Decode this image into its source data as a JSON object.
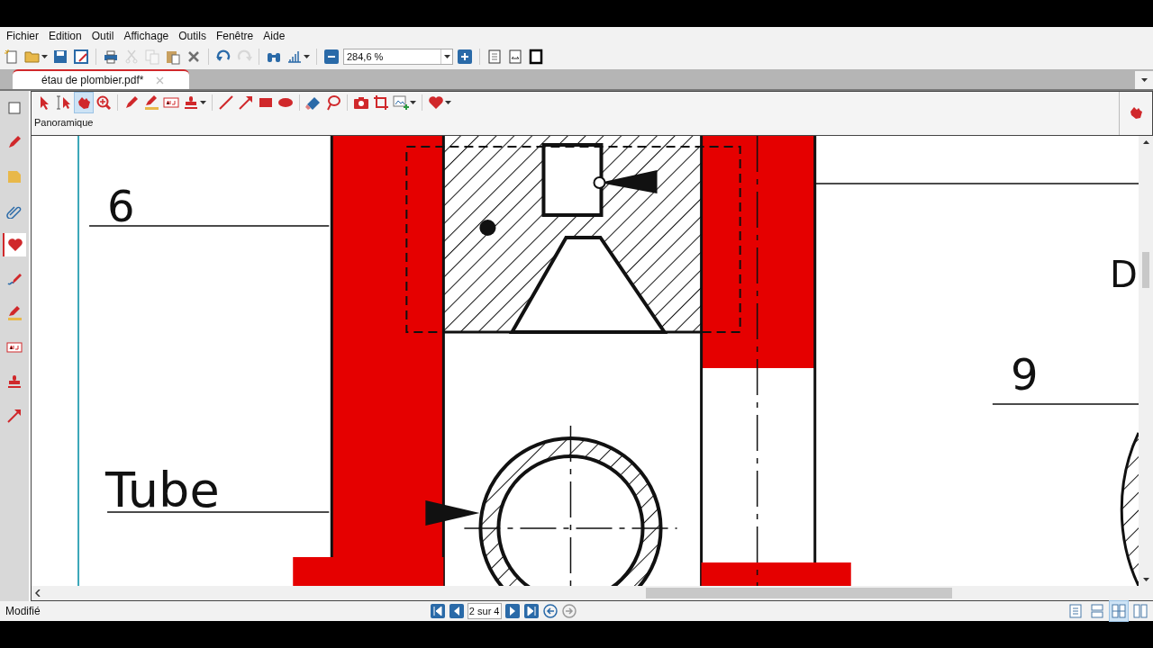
{
  "menu": [
    {
      "label": "Fichier"
    },
    {
      "label": "Edition"
    },
    {
      "label": "Outil"
    },
    {
      "label": "Affichage"
    },
    {
      "label": "Outils"
    },
    {
      "label": "Fenêtre"
    },
    {
      "label": "Aide"
    }
  ],
  "toolbar": {
    "groups": [
      [
        {
          "kind": "new",
          "disabled": false
        },
        {
          "kind": "open",
          "disabled": false
        },
        {
          "kind": "save",
          "disabled": false
        },
        {
          "kind": "saveas",
          "disabled": false
        }
      ],
      [
        {
          "kind": "print",
          "disabled": false
        },
        {
          "kind": "cut",
          "disabled": true
        },
        {
          "kind": "copy",
          "disabled": true
        },
        {
          "kind": "paste",
          "disabled": false
        },
        {
          "kind": "delete",
          "disabled": false
        }
      ],
      [
        {
          "kind": "undo",
          "disabled": false
        },
        {
          "kind": "redo",
          "disabled": true
        }
      ],
      [
        {
          "kind": "find",
          "disabled": false
        },
        {
          "kind": "tools",
          "disabled": false
        }
      ],
      [
        {
          "kind": "zoomout",
          "disabled": false
        },
        {
          "kind": "zoomfield",
          "disabled": false
        },
        {
          "kind": "zoomin",
          "disabled": false
        }
      ],
      [
        {
          "kind": "fitpage",
          "disabled": false
        },
        {
          "kind": "fitwidth",
          "disabled": false
        },
        {
          "kind": "fullscreen",
          "disabled": false
        }
      ]
    ],
    "zoom_value": "284,6 %"
  },
  "tab": {
    "title": "étau de plombier.pdf*"
  },
  "annotation_toolbar": {
    "mode_label": "Panoramique",
    "groups": [
      [
        {
          "kind": "select",
          "selected": false
        },
        {
          "kind": "textselect",
          "selected": false
        },
        {
          "kind": "hand",
          "selected": true
        },
        {
          "kind": "zoom",
          "selected": false
        }
      ],
      [
        {
          "kind": "pen",
          "selected": false
        },
        {
          "kind": "highlighter",
          "selected": false
        },
        {
          "kind": "textbox",
          "selected": false
        },
        {
          "kind": "stamp",
          "selected": false
        }
      ],
      [
        {
          "kind": "line",
          "selected": false
        },
        {
          "kind": "arrow",
          "selected": false
        },
        {
          "kind": "rect",
          "selected": false
        },
        {
          "kind": "ellipse",
          "selected": false
        }
      ],
      [
        {
          "kind": "eraser",
          "selected": false
        },
        {
          "kind": "lasso",
          "selected": false
        }
      ],
      [
        {
          "kind": "camera",
          "selected": false
        },
        {
          "kind": "crop",
          "selected": false
        },
        {
          "kind": "image",
          "selected": false
        }
      ],
      [
        {
          "kind": "heart",
          "selected": false
        }
      ]
    ]
  },
  "sidebar": {
    "tabs": [
      {
        "kind": "blank",
        "selected": false
      },
      {
        "kind": "pen",
        "selected": false
      },
      {
        "kind": "note",
        "selected": false
      },
      {
        "kind": "clip",
        "selected": false
      },
      {
        "kind": "heart",
        "selected": true
      },
      {
        "kind": "curvepen",
        "selected": false
      },
      {
        "kind": "highlighter",
        "selected": false
      },
      {
        "kind": "textbox",
        "selected": false
      },
      {
        "kind": "stamp",
        "selected": false
      },
      {
        "kind": "arrow",
        "selected": false
      }
    ]
  },
  "drawing": {
    "labels": [
      "6",
      "Tube",
      "9",
      "D"
    ]
  },
  "status_bar": {
    "state": "Modifié",
    "page": "2 sur 4",
    "views": [
      {
        "kind": "single",
        "selected": false
      },
      {
        "kind": "continuous",
        "selected": false
      },
      {
        "kind": "facing",
        "selected": true
      },
      {
        "kind": "facingcont",
        "selected": false
      }
    ]
  }
}
